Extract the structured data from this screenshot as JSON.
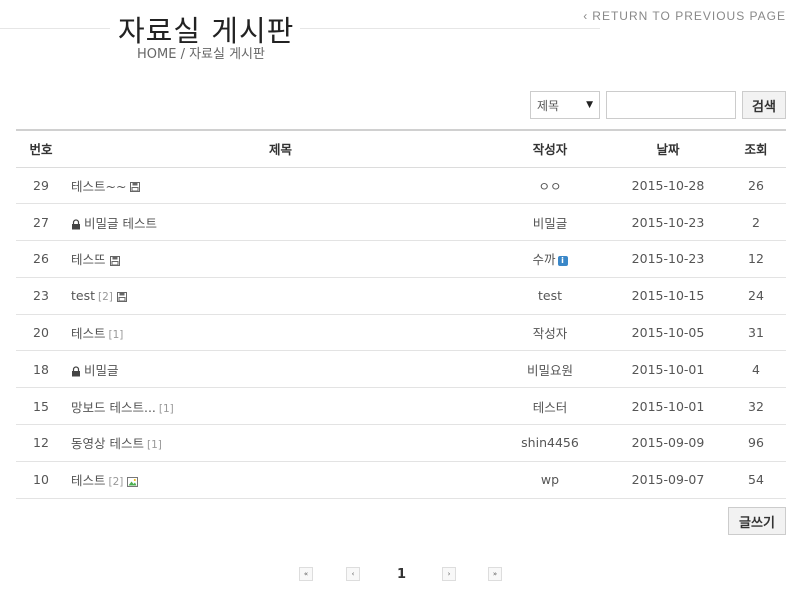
{
  "header": {
    "title": "자료실 게시판",
    "breadcrumb": "HOME / 자료실 게시판",
    "return_link": "RETURN TO PREVIOUS PAGE"
  },
  "search": {
    "select_value": "제목",
    "input_value": "",
    "button_label": "검색"
  },
  "table": {
    "headers": [
      "번호",
      "제목",
      "작성자",
      "날짜",
      "조회"
    ],
    "rows": [
      {
        "num": "29",
        "title": "테스트~~",
        "comments": "",
        "author": "ㅇㅇ",
        "date": "2015-10-28",
        "views": "26"
      },
      {
        "num": "27",
        "title": "비밀글 테스트",
        "comments": "",
        "author": "비밀글",
        "date": "2015-10-23",
        "views": "2"
      },
      {
        "num": "26",
        "title": "테스뜨",
        "comments": "",
        "author": "수까",
        "date": "2015-10-23",
        "views": "12"
      },
      {
        "num": "23",
        "title": "test",
        "comments": "[2]",
        "author": "test",
        "date": "2015-10-15",
        "views": "24"
      },
      {
        "num": "20",
        "title": "테스트",
        "comments": "[1]",
        "author": "작성자",
        "date": "2015-10-05",
        "views": "31"
      },
      {
        "num": "18",
        "title": "비밀글",
        "comments": "",
        "author": "비밀요원",
        "date": "2015-10-01",
        "views": "4"
      },
      {
        "num": "15",
        "title": "망보드 테스트...",
        "comments": "[1]",
        "author": "테스터",
        "date": "2015-10-01",
        "views": "32"
      },
      {
        "num": "12",
        "title": "동영상 테스트",
        "comments": "[1]",
        "author": "shin4456",
        "date": "2015-09-09",
        "views": "96"
      },
      {
        "num": "10",
        "title": "테스트",
        "comments": "[2]",
        "author": "wp",
        "date": "2015-09-07",
        "views": "54"
      }
    ]
  },
  "write_button": "글쓰기",
  "pagination": {
    "first": "«",
    "prev": "‹",
    "current": "1",
    "next": "›",
    "last": "»"
  },
  "icons": {
    "attachment": "floppy-disk-icon",
    "secret": "lock-icon",
    "image": "image-icon",
    "member_badge": "info-badge-icon"
  }
}
